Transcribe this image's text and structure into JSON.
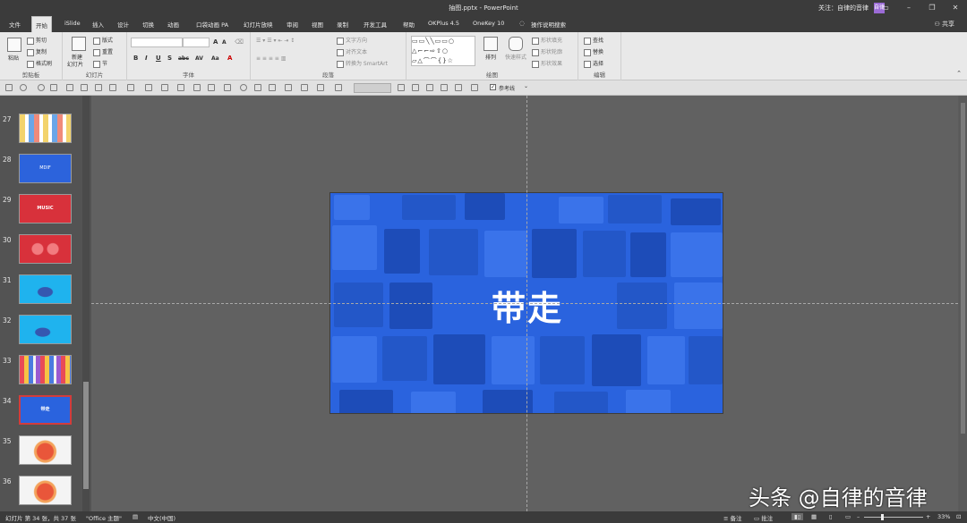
{
  "window": {
    "doc_title": "抽图.pptx - PowerPoint",
    "user_text": "关注：自律的音律",
    "avatar_text": "自律",
    "minimize_icon": "minimize-icon",
    "restore_icon": "restore-icon",
    "close_icon": "close-icon"
  },
  "tabs": [
    "文件",
    "开始",
    "iSlide",
    "插入",
    "设计",
    "切换",
    "动画",
    "口袋动画 PA",
    "幻灯片放映",
    "审阅",
    "视图",
    "录制",
    "开发工具",
    "帮助",
    "OKPlus 4.5",
    "OneKey 10",
    "操作说明搜索"
  ],
  "active_tab": "开始",
  "share_label": "共享",
  "ribbon": {
    "clipboard": {
      "group_label": "剪贴板",
      "paste": "粘贴",
      "cut": "剪切",
      "copy": "复制",
      "format_painter": "格式刷"
    },
    "slides": {
      "group_label": "幻灯片",
      "new_slide": "新建",
      "new_slide2": "幻灯片",
      "layout": "版式",
      "reset": "重置",
      "section": "节"
    },
    "font": {
      "group_label": "字体",
      "bold": "B",
      "italic": "I",
      "underline": "U",
      "shadow": "S",
      "strike": "abc",
      "spacing": "AV",
      "case": "Aa",
      "grow": "A",
      "shrink": "A",
      "color": "A"
    },
    "paragraph": {
      "group_label": "段落",
      "text_direction": "文字方向",
      "align_text": "对齐文本",
      "smartart": "转换为 SmartArt"
    },
    "drawing": {
      "group_label": "绘图",
      "arrange": "排列",
      "quick_styles": "快速样式",
      "shape_fill": "形状填充",
      "shape_outline": "形状轮廓",
      "shape_effects": "形状效果"
    },
    "editing": {
      "group_label": "编辑",
      "find": "查找",
      "replace": "替换",
      "select": "选择"
    }
  },
  "qat": {
    "guides_checkbox_label": "参考线",
    "guides_checked": true
  },
  "thumbnails": [
    {
      "num": "27",
      "label": "",
      "kind": "colorful"
    },
    {
      "num": "28",
      "label": "MDIF",
      "kind": "blue"
    },
    {
      "num": "29",
      "label": "MUSIC",
      "kind": "red"
    },
    {
      "num": "30",
      "label": "",
      "kind": "red-dots"
    },
    {
      "num": "31",
      "label": "",
      "kind": "cyan"
    },
    {
      "num": "32",
      "label": "",
      "kind": "cyan"
    },
    {
      "num": "33",
      "label": "",
      "kind": "collage"
    },
    {
      "num": "34",
      "label": "带走",
      "kind": "blue-selected"
    },
    {
      "num": "35",
      "label": "",
      "kind": "white-heart"
    },
    {
      "num": "36",
      "label": "",
      "kind": "white-heart"
    }
  ],
  "slide": {
    "title": "带走",
    "bg_color": "#2a63de"
  },
  "status": {
    "slide_pos": "幻灯片 第 34 张，共 37 张",
    "theme": "\"Office 主题\"",
    "language": "中文(中国)",
    "notes": "备注",
    "comments": "批注",
    "zoom": "33%"
  },
  "watermark": "头条 @自律的音律"
}
